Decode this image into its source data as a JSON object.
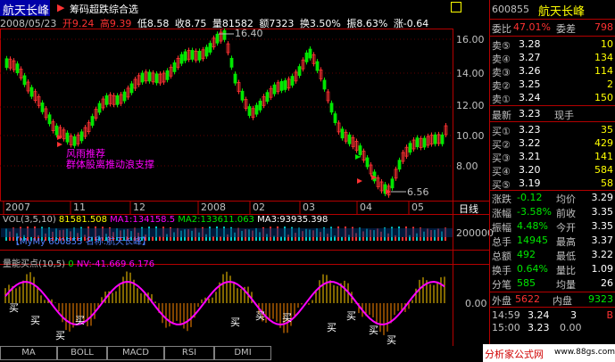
{
  "header": {
    "stock_name": "航天长峰",
    "screener_label": "筹码超跌综合选",
    "arrow_flag": "▶"
  },
  "infobar": {
    "date": "2008/05/23",
    "open": "开9.24",
    "high": "高9.39",
    "low": "低8.58",
    "close": "收8.75",
    "volume": "量81582",
    "amount": "额7323",
    "turnover": "换3.50%",
    "amplitude": "振8.63%",
    "change": "涨-0.64"
  },
  "main_chart": {
    "price_labels": [
      "16.00",
      "14.00",
      "12.00",
      "10.00",
      "8.00"
    ],
    "high_mark": "16.40",
    "low_mark": "6.56",
    "annotation_1": "风雨推荐",
    "annotation_2": "群体股离推动浪支撑",
    "x_labels": [
      "2007",
      "11",
      "12",
      "2008",
      "02",
      "03",
      "04",
      "05"
    ],
    "period_label": "日线"
  },
  "vol_panel": {
    "title": "VOL(3,5,10)",
    "vol_value": "81581.508",
    "ma1": "MA1:134158.5",
    "ma2": "MA2:133611.063",
    "ma3": "MA3:93935.398",
    "scale_label": "200000",
    "watermark": "【MyMy 600855 名称:航天长峰】"
  },
  "indicator_panel": {
    "title": "量能买点(10,5)",
    "zero": "0",
    "nv": "NV:-41.669",
    "second": "6.176",
    "zero_label": "0.00",
    "buy_label": "买"
  },
  "bottom_tabs": [
    "MA",
    "BOLL",
    "MACD",
    "RSI",
    "DMI"
  ],
  "right_panel": {
    "code": "600855",
    "name": "航天长峰",
    "weibi_label": "委比",
    "weibi_value": "47.01%",
    "weicha_label": "委差",
    "weicha_value": "798",
    "sell_rows": [
      {
        "label": "卖⑤",
        "price": "3.28",
        "vol": "10"
      },
      {
        "label": "卖④",
        "price": "3.27",
        "vol": "134"
      },
      {
        "label": "卖③",
        "price": "3.26",
        "vol": "114"
      },
      {
        "label": "卖②",
        "price": "3.25",
        "vol": "2"
      },
      {
        "label": "卖①",
        "price": "3.24",
        "vol": "150"
      }
    ],
    "latest_label": "最新",
    "latest_price": "3.23",
    "xianshou_label": "现手",
    "buy_rows": [
      {
        "label": "买①",
        "price": "3.23",
        "vol": "35"
      },
      {
        "label": "买②",
        "price": "3.22",
        "vol": "429"
      },
      {
        "label": "买③",
        "price": "3.21",
        "vol": "141"
      },
      {
        "label": "买④",
        "price": "3.20",
        "vol": "584"
      },
      {
        "label": "买⑤",
        "price": "3.19",
        "vol": "58"
      }
    ],
    "stats": [
      {
        "l1": "涨跌",
        "v1": "-0.12",
        "l2": "均价",
        "v2": "3.29"
      },
      {
        "l1": "涨幅",
        "v1": "-3.58%",
        "l2": "前收",
        "v2": "3.35"
      },
      {
        "l1": "振幅",
        "v1": "4.48%",
        "l2": "今开",
        "v2": "3.35"
      },
      {
        "l1": "总手",
        "v1": "14945",
        "l2": "最高",
        "v2": "3.37"
      },
      {
        "l1": "总额",
        "v1": "492",
        "l2": "最低",
        "v2": "3.22"
      },
      {
        "l1": "换手",
        "v1": "0.64%",
        "l2": "量比",
        "v2": "1.09"
      },
      {
        "l1": "分笔",
        "v1": "585",
        "l2": "均量",
        "v2": "26"
      }
    ],
    "outer_label": "外盘",
    "outer_value": "5622",
    "inner_label": "内盘",
    "inner_value": "9323",
    "ticks": [
      {
        "time": "14:59",
        "price": "3.24",
        "vol": "3",
        "flag": "B"
      },
      {
        "time": "15:00",
        "price": "3.23",
        "vol": "",
        "flag": ""
      }
    ],
    "tick_zero": "0.00",
    "footer": "分析家公式网",
    "footer_url": "www.88gs.com"
  },
  "colors": {
    "up": "#ff3232",
    "down": "#00e600",
    "ma": "#ff00ff",
    "panel_border": "#b40000"
  }
}
